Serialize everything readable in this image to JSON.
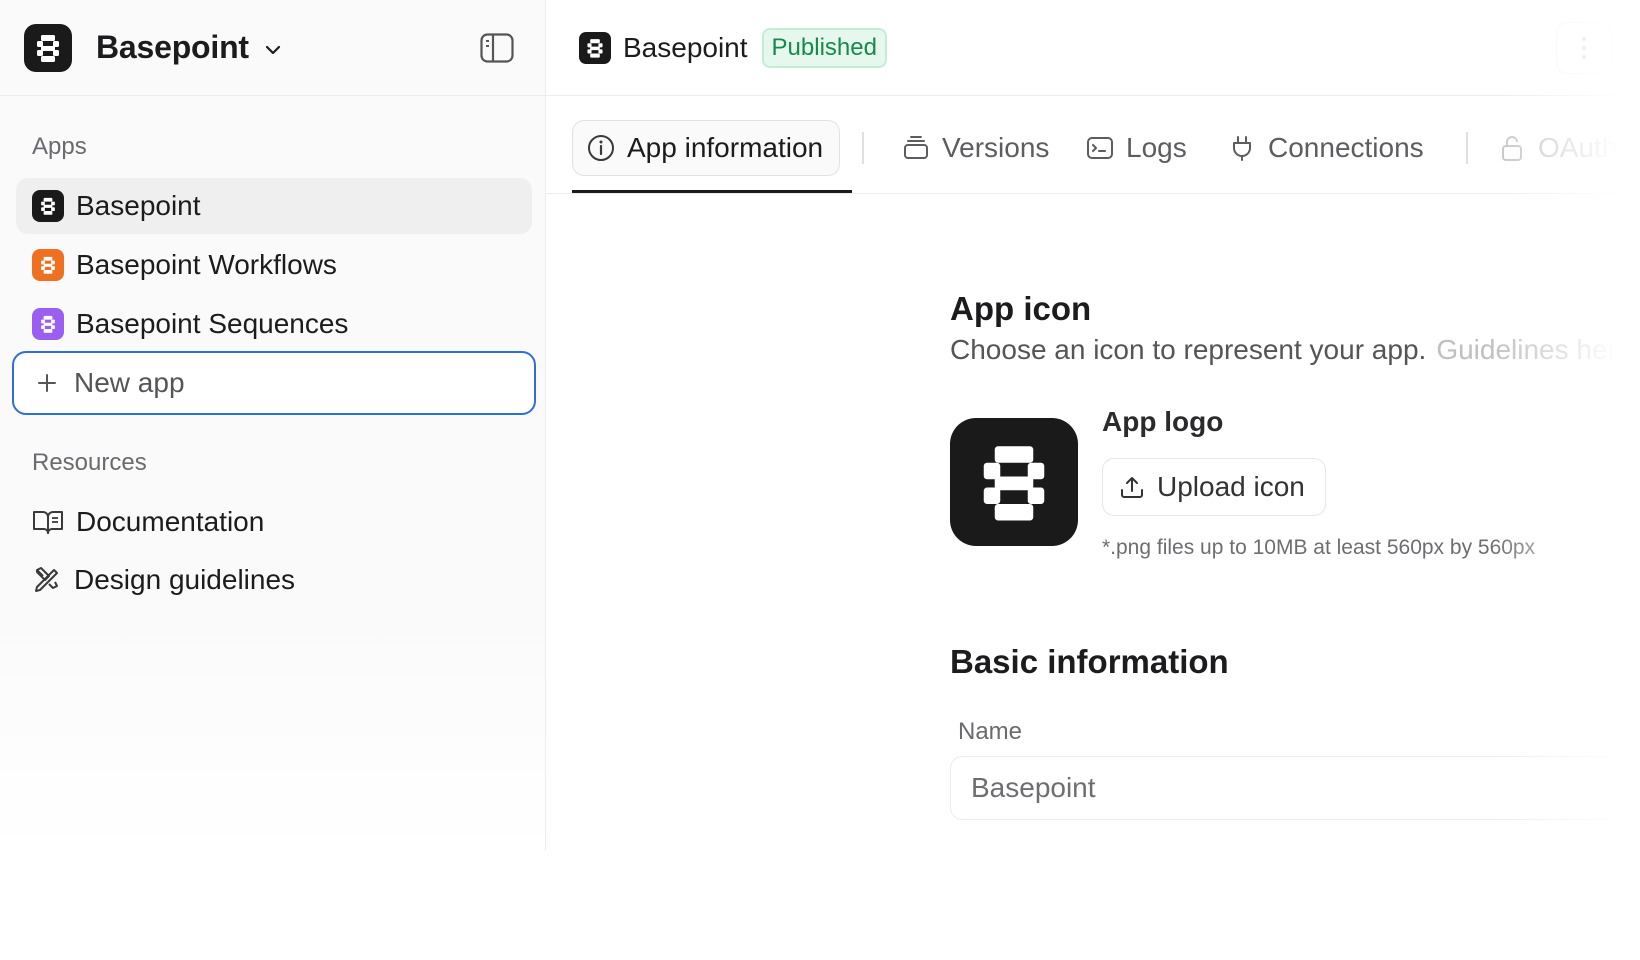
{
  "workspace": {
    "name": "Basepoint"
  },
  "sidebar": {
    "apps_label": "Apps",
    "apps": [
      {
        "label": "Basepoint",
        "color": "#1a1a1a",
        "active": true
      },
      {
        "label": "Basepoint Workflows",
        "color": "#f07022",
        "active": false
      },
      {
        "label": "Basepoint Sequences",
        "color": "#9a5ff0",
        "active": false
      }
    ],
    "new_app_label": "New app",
    "resources_label": "Resources",
    "resources": [
      {
        "label": "Documentation",
        "icon": "book-icon"
      },
      {
        "label": "Design guidelines",
        "icon": "design-tools-icon"
      }
    ]
  },
  "header": {
    "title": "Basepoint",
    "status": "Published"
  },
  "tabs": [
    {
      "label": "App information",
      "icon": "info-icon",
      "active": true
    },
    {
      "label": "Versions",
      "icon": "stack-icon"
    },
    {
      "label": "Logs",
      "icon": "terminal-icon"
    },
    {
      "label": "Connections",
      "icon": "plug-icon"
    },
    {
      "label": "OAuth",
      "icon": "lock-icon"
    }
  ],
  "app_icon": {
    "heading": "App icon",
    "description": "Choose an icon to represent your app.",
    "guidelines_link": "Guidelines her",
    "logo_title": "App logo",
    "upload_label": "Upload icon",
    "hint": "*.png files up to 10MB at least 560px by 560px"
  },
  "basic_info": {
    "heading": "Basic information",
    "name_label": "Name",
    "name_value": "Basepoint"
  },
  "colors": {
    "accent_blue": "#2f6fdb",
    "published_green": "#148a4b"
  }
}
